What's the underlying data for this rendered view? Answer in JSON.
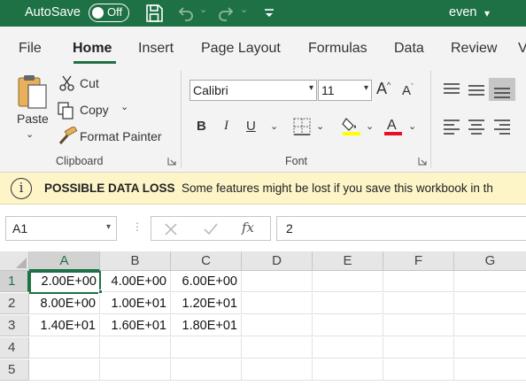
{
  "titlebar": {
    "autosave_label": "AutoSave",
    "autosave_state": "Off",
    "user_name": "even",
    "user_dropdown": "▾"
  },
  "tabs": [
    "File",
    "Home",
    "Insert",
    "Page Layout",
    "Formulas",
    "Data",
    "Review",
    "V"
  ],
  "active_tab": "Home",
  "clipboard": {
    "paste_label": "Paste",
    "cut_label": "Cut",
    "copy_label": "Copy",
    "format_painter_label": "Format Painter",
    "group_label": "Clipboard"
  },
  "font": {
    "font_name": "Calibri",
    "font_size": "11",
    "bold": "B",
    "italic": "I",
    "underline": "U",
    "group_label": "Font",
    "highlight_color": "#ffff00",
    "font_color": "#e81123"
  },
  "message_bar": {
    "title": "POSSIBLE DATA LOSS",
    "text": "Some features might be lost if you save this workbook in th"
  },
  "formula_bar": {
    "name_box": "A1",
    "fx_label": "fx",
    "value": "2"
  },
  "grid": {
    "columns": [
      "A",
      "B",
      "C",
      "D",
      "E",
      "F",
      "G"
    ],
    "rows": [
      "1",
      "2",
      "3",
      "4",
      "5"
    ],
    "cells": [
      [
        "2.00E+00",
        "4.00E+00",
        "6.00E+00"
      ],
      [
        "8.00E+00",
        "1.00E+01",
        "1.20E+01"
      ],
      [
        "1.40E+01",
        "1.60E+01",
        "1.80E+01"
      ]
    ],
    "active_cell": "A1"
  },
  "colors": {
    "accent": "#1e7145",
    "message_bar": "#fdf4c8"
  }
}
